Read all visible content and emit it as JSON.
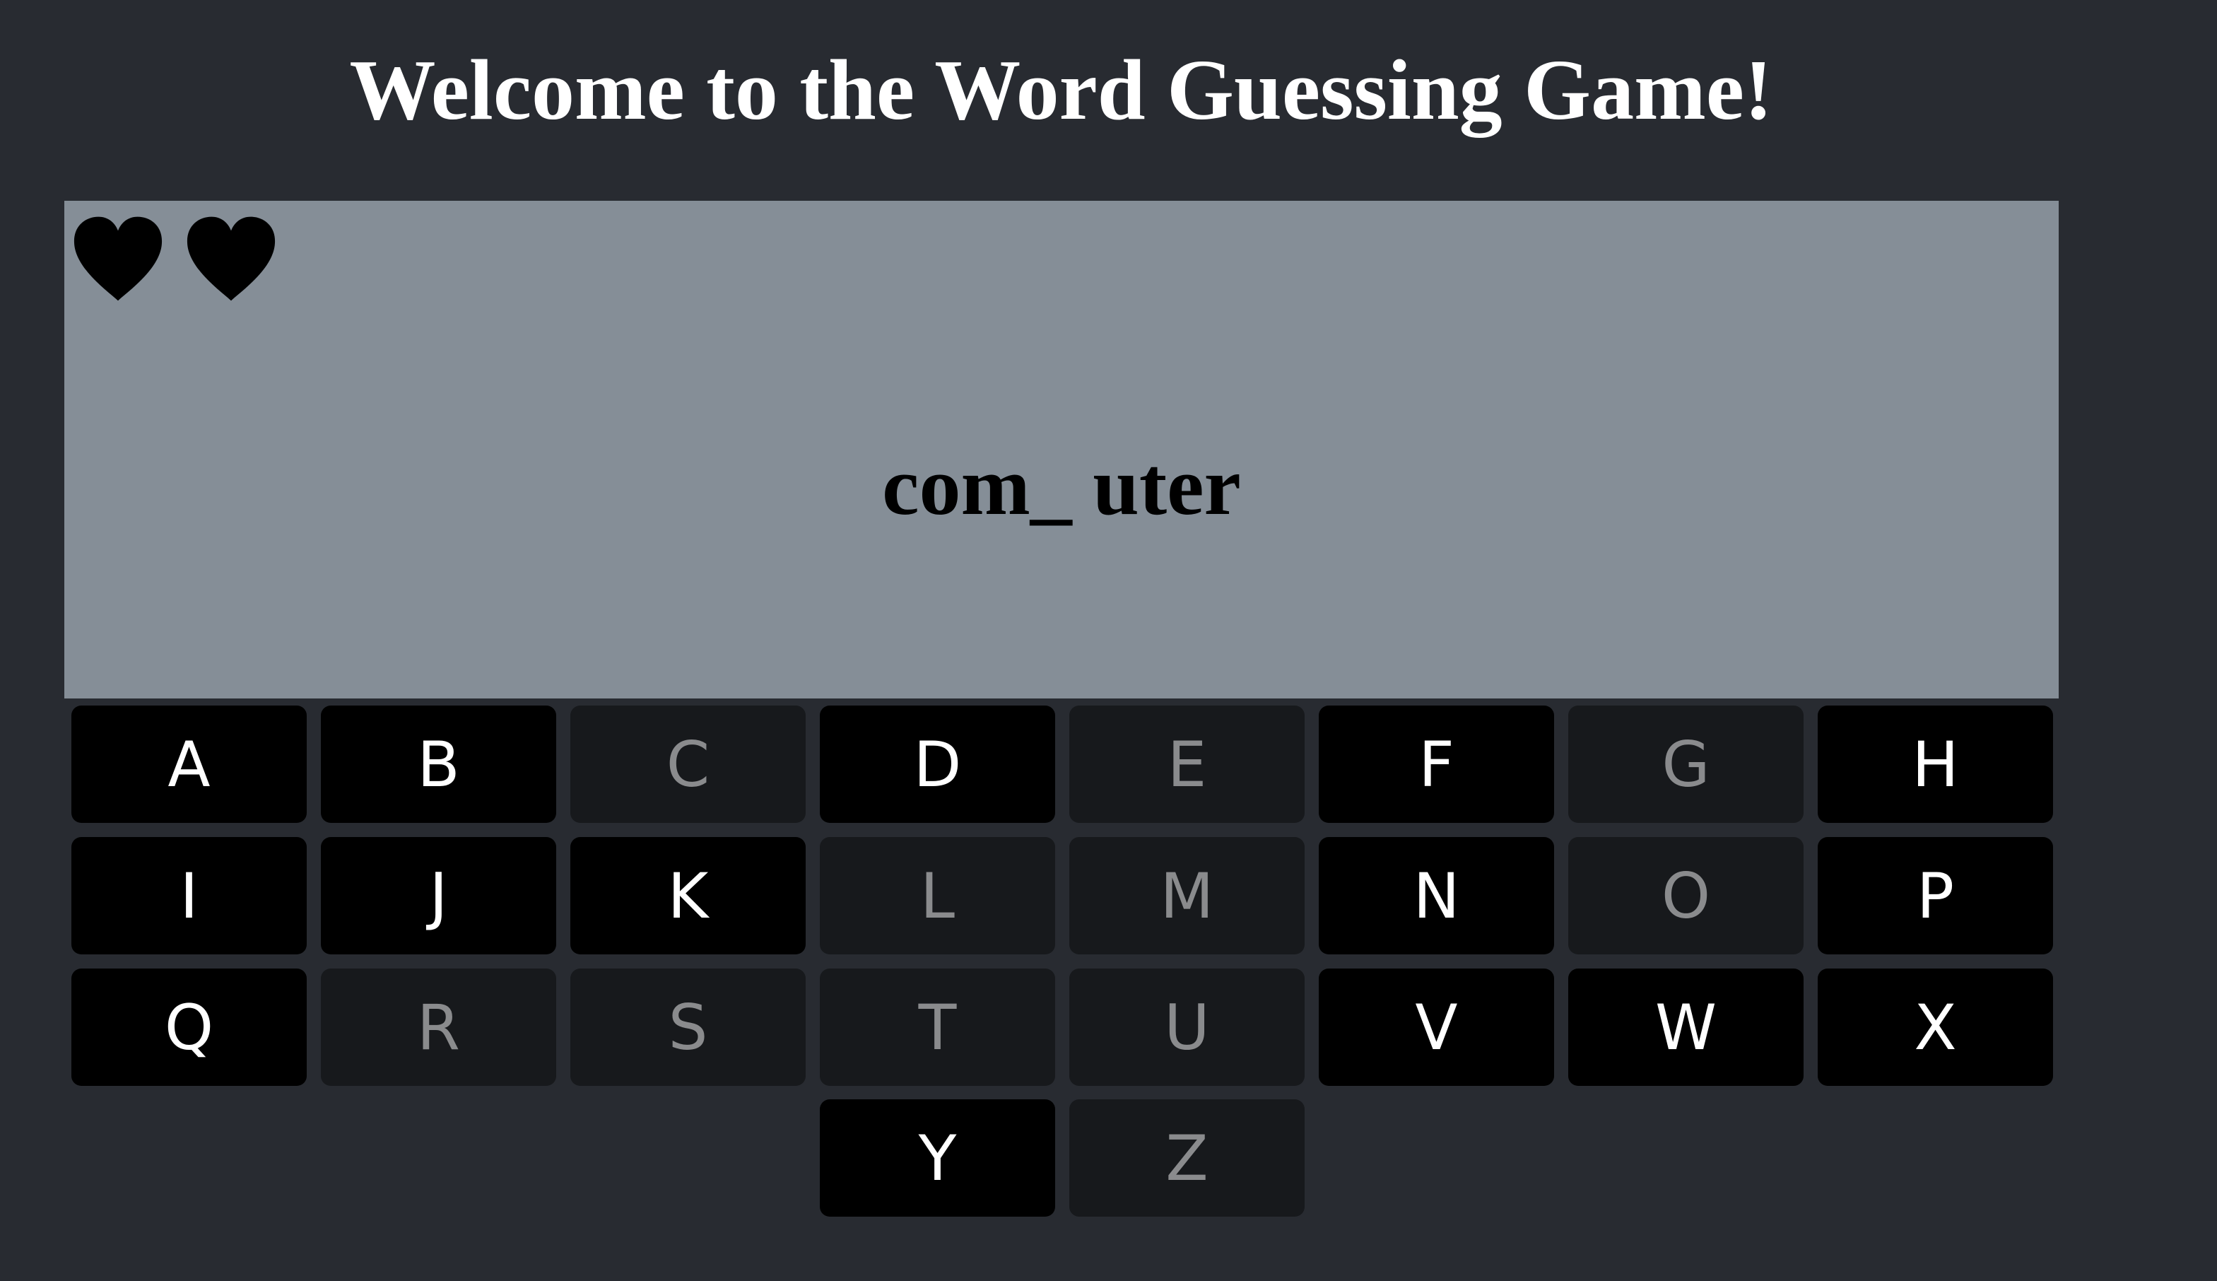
{
  "header": {
    "title": "Welcome to the Word Guessing Game!"
  },
  "game": {
    "lives_remaining": 2,
    "word_display": "com_ uter",
    "heart_icon": "heart-icon",
    "heart_color": "#000000",
    "board_color": "#858e97"
  },
  "keyboard": {
    "rows": [
      [
        {
          "letter": "A",
          "state": "active"
        },
        {
          "letter": "B",
          "state": "active"
        },
        {
          "letter": "C",
          "state": "used"
        },
        {
          "letter": "D",
          "state": "active"
        },
        {
          "letter": "E",
          "state": "used"
        },
        {
          "letter": "F",
          "state": "active"
        },
        {
          "letter": "G",
          "state": "used"
        },
        {
          "letter": "H",
          "state": "active"
        }
      ],
      [
        {
          "letter": "I",
          "state": "active"
        },
        {
          "letter": "J",
          "state": "active"
        },
        {
          "letter": "K",
          "state": "active"
        },
        {
          "letter": "L",
          "state": "used"
        },
        {
          "letter": "M",
          "state": "used"
        },
        {
          "letter": "N",
          "state": "active"
        },
        {
          "letter": "O",
          "state": "used"
        },
        {
          "letter": "P",
          "state": "active"
        }
      ],
      [
        {
          "letter": "Q",
          "state": "active"
        },
        {
          "letter": "R",
          "state": "used"
        },
        {
          "letter": "S",
          "state": "used"
        },
        {
          "letter": "T",
          "state": "used"
        },
        {
          "letter": "U",
          "state": "used"
        },
        {
          "letter": "V",
          "state": "active"
        },
        {
          "letter": "W",
          "state": "active"
        },
        {
          "letter": "X",
          "state": "active"
        }
      ],
      [
        {
          "letter": "Y",
          "state": "active"
        },
        {
          "letter": "Z",
          "state": "used"
        }
      ]
    ]
  }
}
